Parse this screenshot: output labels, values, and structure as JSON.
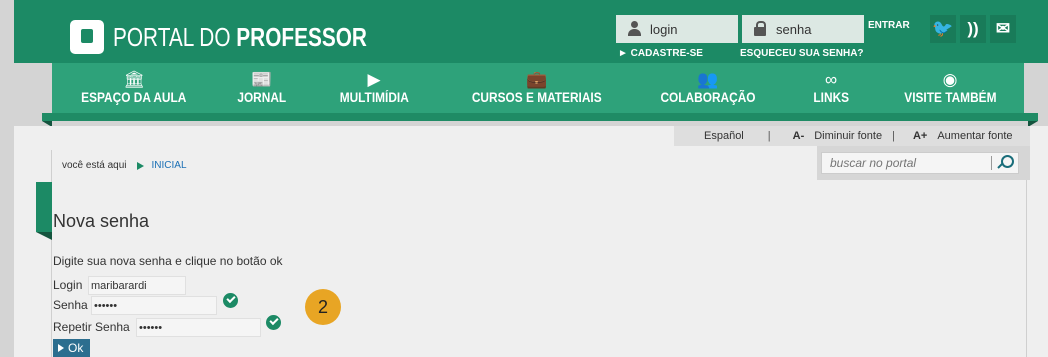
{
  "brand": {
    "name_light": "PORTAL DO",
    "name_bold": "PROFESSOR",
    "color": "#1c8a65"
  },
  "header": {
    "login_placeholder": "login",
    "senha_placeholder": "senha",
    "entrar_label": "ENTRAR",
    "cadastre_label": "► CADASTRE-SE",
    "esqueceu_label": "ESQUECEU SUA SENHA?",
    "social_icons": [
      "twitter-icon",
      "rss-icon",
      "mail-icon"
    ]
  },
  "nav": {
    "items": [
      {
        "label": "ESPAÇO DA AULA",
        "icon": "bank-icon"
      },
      {
        "label": "JORNAL",
        "icon": "newspaper-icon"
      },
      {
        "label": "MULTIMÍDIA",
        "icon": "play-icon"
      },
      {
        "label": "CURSOS E MATERIAIS",
        "icon": "briefcase-icon"
      },
      {
        "label": "COLABORAÇÃO",
        "icon": "users-icon"
      },
      {
        "label": "LINKS",
        "icon": "link-icon"
      },
      {
        "label": "VISITE TAMBÉM",
        "icon": "eye-icon"
      }
    ]
  },
  "tools": {
    "language": "Español",
    "decrease_prefix": "A-",
    "decrease_label": "Diminuir fonte",
    "increase_prefix": "A+",
    "increase_label": "Aumentar fonte"
  },
  "search": {
    "placeholder": "buscar no portal"
  },
  "breadcrumb": {
    "prefix": "você está aqui",
    "current": "INICIAL"
  },
  "page": {
    "title": "Nova senha",
    "instruction": "Digite sua nova senha e clique no botão ok"
  },
  "form": {
    "login_label": "Login",
    "login_value": "maribarardi",
    "senha_label": "Senha",
    "senha_value": "••••••",
    "repetir_label": "Repetir Senha",
    "repetir_value": "••••••",
    "ok_label": "Ok"
  },
  "annotation": {
    "badge": "2",
    "color": "#e8a524"
  }
}
